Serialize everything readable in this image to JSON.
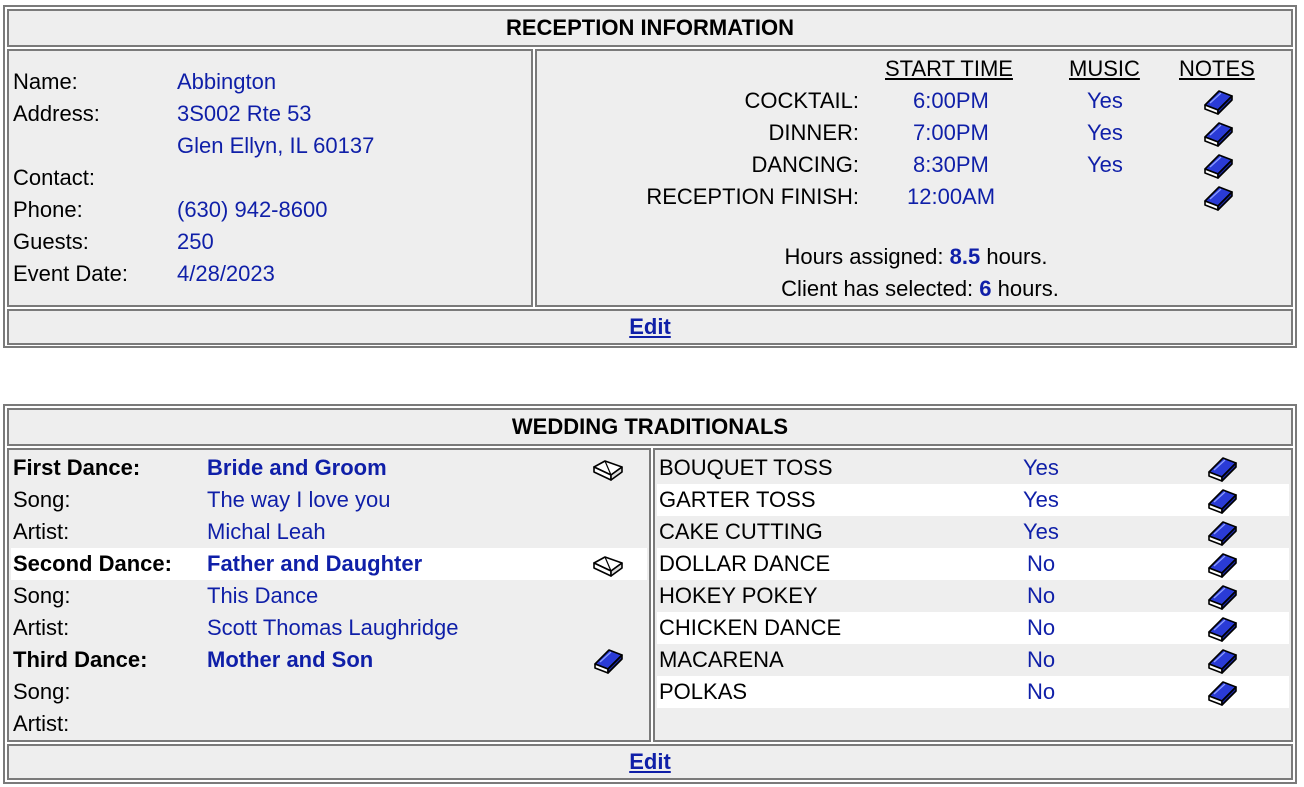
{
  "reception": {
    "title": "RECEPTION INFORMATION",
    "labels": {
      "name": "Name:",
      "address": "Address:",
      "contact": "Contact:",
      "phone": "Phone:",
      "guests": "Guests:",
      "event_date": "Event Date:"
    },
    "name": "Abbington",
    "address1": "3S002 Rte 53",
    "address2": "Glen Ellyn, IL 60137",
    "contact": "",
    "phone": "(630) 942-8600",
    "guests": "250",
    "event_date": "4/28/2023",
    "columns": {
      "start_time": "START TIME",
      "music": "MUSIC",
      "notes": "NOTES"
    },
    "events": [
      {
        "label": "COCKTAIL:",
        "time": "6:00PM",
        "music": "Yes"
      },
      {
        "label": "DINNER:",
        "time": "7:00PM",
        "music": "Yes"
      },
      {
        "label": "DANCING:",
        "time": "8:30PM",
        "music": "Yes"
      },
      {
        "label": "RECEPTION FINISH:",
        "time": "12:00AM",
        "music": ""
      }
    ],
    "hours_assigned_prefix": "Hours assigned:",
    "hours_assigned": "8.5",
    "hours_suffix": "hours.",
    "client_selected_prefix": "Client has selected:",
    "client_selected": "6",
    "edit": "Edit"
  },
  "traditionals": {
    "title": "WEDDING TRADITIONALS",
    "song_label": "Song:",
    "artist_label": "Artist:",
    "dances": [
      {
        "label": "First Dance:",
        "name": "Bride and Groom",
        "song": "The way I love you",
        "artist": "Michal Leah",
        "note_icon": "open-book-outline-icon"
      },
      {
        "label": "Second Dance:",
        "name": "Father and Daughter",
        "song": "This Dance",
        "artist": "Scott Thomas Laughridge",
        "note_icon": "open-book-outline-icon"
      },
      {
        "label": "Third Dance:",
        "name": "Mother and Son",
        "song": "",
        "artist": "",
        "note_icon": "blue-book-icon"
      }
    ],
    "items": [
      {
        "label": "BOUQUET TOSS",
        "value": "Yes"
      },
      {
        "label": "GARTER TOSS",
        "value": "Yes"
      },
      {
        "label": "CAKE CUTTING",
        "value": "Yes"
      },
      {
        "label": "DOLLAR DANCE",
        "value": "No"
      },
      {
        "label": "HOKEY POKEY",
        "value": "No"
      },
      {
        "label": "CHICKEN DANCE",
        "value": "No"
      },
      {
        "label": "MACARENA",
        "value": "No"
      },
      {
        "label": "POLKAS",
        "value": "No"
      }
    ],
    "edit": "Edit"
  },
  "colors": {
    "link": "#0f1fa8",
    "cell_bg": "#eeeeee",
    "border": "#7a7a7a"
  }
}
